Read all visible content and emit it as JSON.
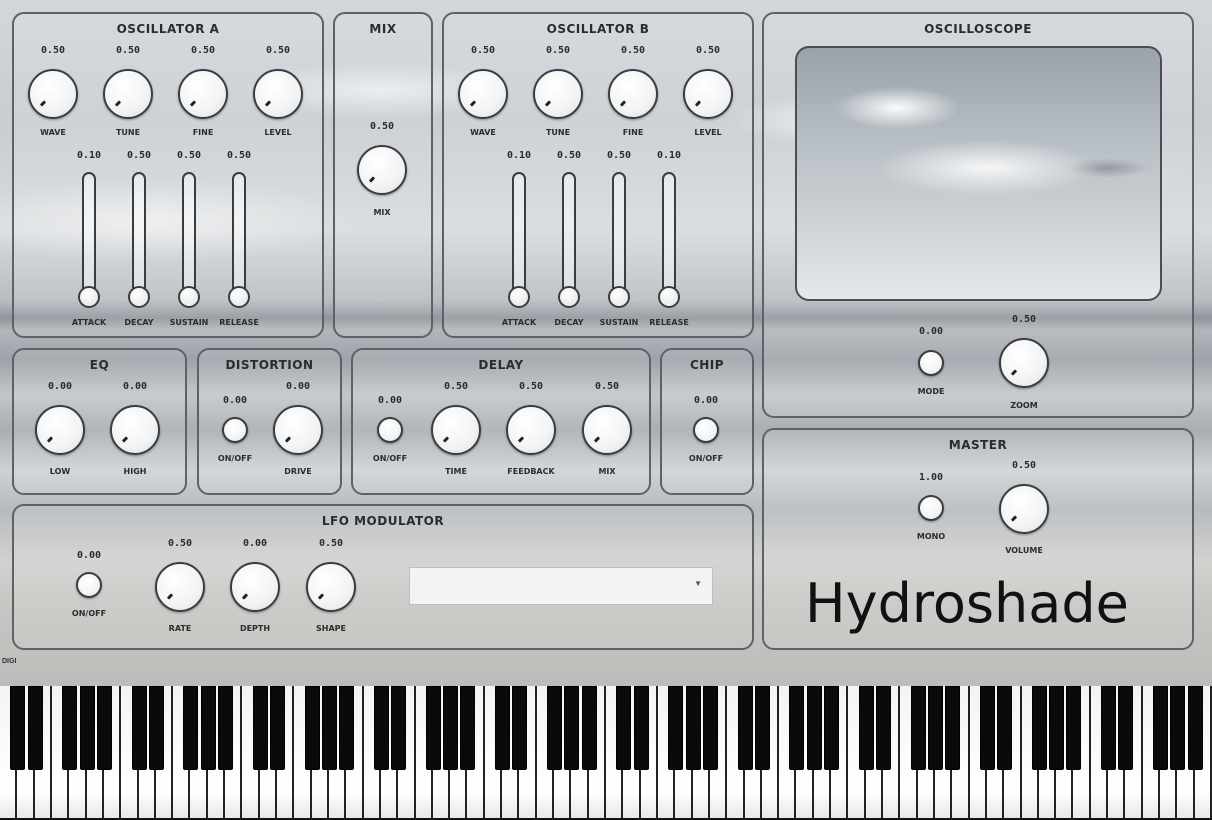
{
  "panels": {
    "osc_a": {
      "title": "OSCILLATOR A"
    },
    "mix": {
      "title": "MIX"
    },
    "osc_b": {
      "title": "OSCILLATOR B"
    },
    "oscilloscope": {
      "title": "OSCILLOSCOPE"
    },
    "eq": {
      "title": "EQ"
    },
    "distortion": {
      "title": "DISTORTION"
    },
    "delay": {
      "title": "DELAY"
    },
    "chip": {
      "title": "CHIP"
    },
    "lfo": {
      "title": "LFO MODULATOR"
    },
    "master": {
      "title": "MASTER"
    }
  },
  "osc_a": {
    "knobs": [
      {
        "value": "0.50",
        "label": "WAVE"
      },
      {
        "value": "0.50",
        "label": "TUNE"
      },
      {
        "value": "0.50",
        "label": "FINE"
      },
      {
        "value": "0.50",
        "label": "LEVEL"
      }
    ],
    "sliders": [
      {
        "value": "0.10",
        "label": "ATTACK",
        "level": 0
      },
      {
        "value": "0.50",
        "label": "DECAY",
        "level": 0
      },
      {
        "value": "0.50",
        "label": "SUSTAIN",
        "level": 0
      },
      {
        "value": "0.50",
        "label": "RELEASE",
        "level": 0
      }
    ]
  },
  "mix": {
    "value": "0.50",
    "label": "MIX"
  },
  "osc_b": {
    "knobs": [
      {
        "value": "0.50",
        "label": "WAVE"
      },
      {
        "value": "0.50",
        "label": "TUNE"
      },
      {
        "value": "0.50",
        "label": "FINE"
      },
      {
        "value": "0.50",
        "label": "LEVEL"
      }
    ],
    "sliders": [
      {
        "value": "0.10",
        "label": "ATTACK",
        "level": 0
      },
      {
        "value": "0.50",
        "label": "DECAY",
        "level": 0
      },
      {
        "value": "0.50",
        "label": "SUSTAIN",
        "level": 0
      },
      {
        "value": "0.10",
        "label": "RELEASE",
        "level": 0
      }
    ]
  },
  "oscilloscope": {
    "small": {
      "value": "0.00",
      "label": "MODE"
    },
    "knob": {
      "value": "0.50",
      "label": "ZOOM"
    }
  },
  "eq": {
    "knobs": [
      {
        "value": "0.00",
        "label": "LOW"
      },
      {
        "value": "0.00",
        "label": "HIGH"
      }
    ]
  },
  "distortion": {
    "small": {
      "value": "0.00",
      "label": "ON/OFF"
    },
    "knob": {
      "value": "0.00",
      "label": "DRIVE"
    }
  },
  "delay": {
    "small": {
      "value": "0.00",
      "label": "ON/OFF"
    },
    "knobs": [
      {
        "value": "0.50",
        "label": "TIME"
      },
      {
        "value": "0.50",
        "label": "FEEDBACK"
      },
      {
        "value": "0.50",
        "label": "MIX"
      }
    ]
  },
  "chip": {
    "small": {
      "value": "0.00",
      "label": "ON/OFF"
    }
  },
  "lfo": {
    "small": {
      "value": "0.00",
      "label": "ON/OFF"
    },
    "knobs": [
      {
        "value": "0.50",
        "label": "RATE"
      },
      {
        "value": "0.00",
        "label": "DEPTH"
      },
      {
        "value": "0.50",
        "label": "SHAPE"
      }
    ],
    "dropdown": {
      "value": ""
    }
  },
  "master": {
    "small": {
      "value": "1.00",
      "label": "MONO"
    },
    "knob": {
      "value": "0.50",
      "label": "VOLUME"
    }
  },
  "brand": "Hydroshade",
  "corner_label": "DIGI",
  "keyboard": {
    "white_keys": 70,
    "black_pattern": [
      1,
      1,
      0,
      1,
      1,
      1,
      0
    ]
  }
}
